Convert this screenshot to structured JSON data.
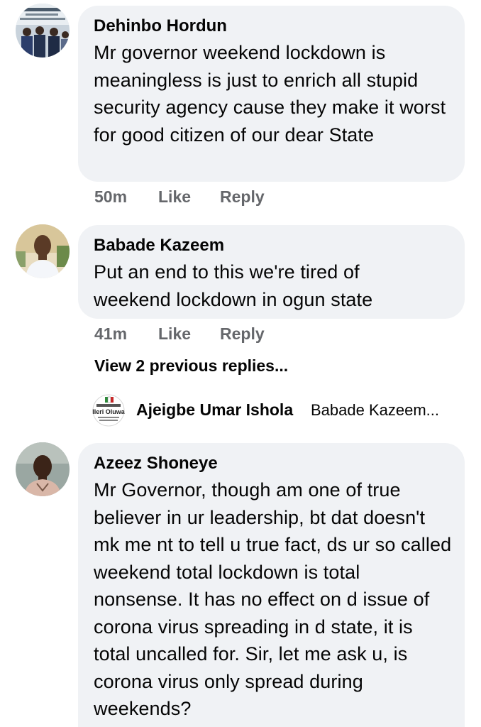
{
  "comments": [
    {
      "author": "Dehinbo Hordun",
      "text": "Mr governor weekend lockdown is meaningless is just to enrich all stupid security agency cause they make it worst for good citizen of our dear State",
      "time": "50m",
      "like_label": "Like",
      "reply_label": "Reply",
      "avatar_icon": "group-photo-avatar"
    },
    {
      "author": "Babade Kazeem",
      "text": "Put an end to this we're tired of weekend lockdown in ogun state",
      "time": "41m",
      "like_label": "Like",
      "reply_label": "Reply",
      "avatar_icon": "profile-photo-avatar",
      "view_previous": "View 2 previous replies...",
      "reply_preview": {
        "author": "Ajeigbe Umar Ishola",
        "snippet": "Babade Kazeem...",
        "avatar_text": "Ileri Oluwa"
      }
    },
    {
      "author": "Azeez Shoneye",
      "text": "Mr Governor, though am one of true believer in ur leadership, bt dat doesn't mk me nt to tell u true fact, ds ur so called weekend total lockdown is total nonsense. It has no effect on d issue of corona virus spreading in d state, it is total uncalled for. Sir, let me ask u, is corona virus only spread during weekends?",
      "avatar_icon": "profile-photo-avatar"
    }
  ],
  "colors": {
    "bubble": "#f0f2f5",
    "meta": "#65676b",
    "text": "#050505"
  }
}
